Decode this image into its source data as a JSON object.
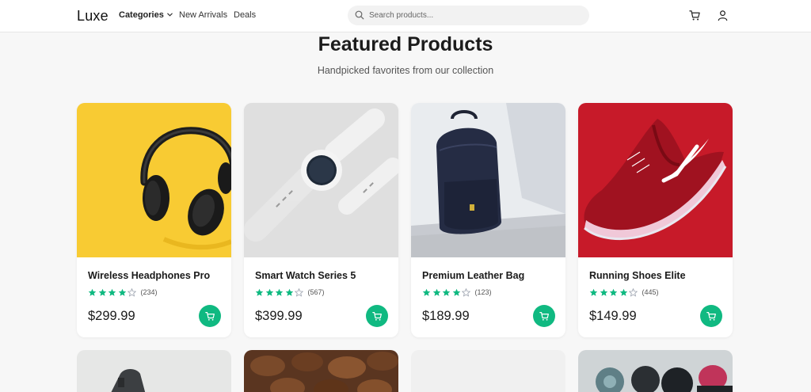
{
  "brand": {
    "logo": "Luxe"
  },
  "nav": {
    "links": [
      {
        "label": "Categories"
      },
      {
        "label": "New Arrivals"
      },
      {
        "label": "Deals"
      }
    ],
    "search_placeholder": "Search products..."
  },
  "section": {
    "title": "Featured Products",
    "subtitle": "Handpicked favorites from our collection"
  },
  "products": [
    {
      "name": "Wireless Headphones Pro",
      "rating": 4,
      "reviews": "(234)",
      "price": "$299.99"
    },
    {
      "name": "Smart Watch Series 5",
      "rating": 4,
      "reviews": "(567)",
      "price": "$399.99"
    },
    {
      "name": "Premium Leather Bag",
      "rating": 4,
      "reviews": "(123)",
      "price": "$189.99"
    },
    {
      "name": "Running Shoes Elite",
      "rating": 4,
      "reviews": "(445)",
      "price": "$149.99"
    }
  ],
  "colors": {
    "accent": "#10b981",
    "star_filled": "#10b981",
    "star_empty": "#9ca3af"
  },
  "icons": [
    "search-icon",
    "chevron-down-icon",
    "cart-icon",
    "user-icon",
    "star-icon"
  ]
}
